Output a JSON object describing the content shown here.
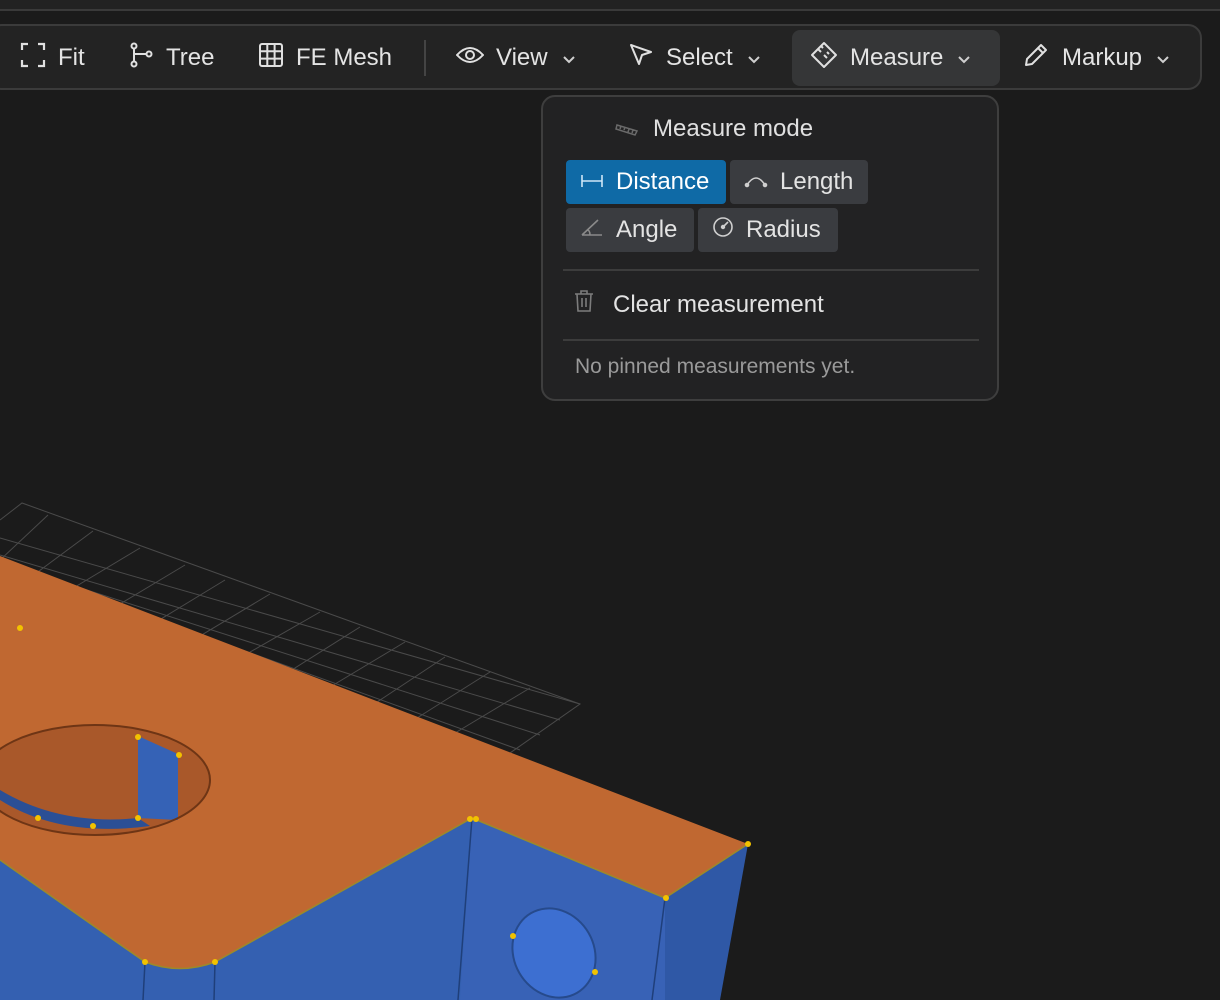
{
  "toolbar": {
    "fit": {
      "label": "Fit",
      "icon": "fit-frame-icon"
    },
    "tree": {
      "label": "Tree",
      "icon": "tree-branch-icon"
    },
    "fe_mesh": {
      "label": "FE Mesh",
      "icon": "grid-mesh-icon"
    },
    "view": {
      "label": "View",
      "icon": "eye-icon"
    },
    "select": {
      "label": "Select",
      "icon": "cursor-arrow-icon"
    },
    "measure": {
      "label": "Measure",
      "icon": "ruler-icon",
      "active": true
    },
    "markup": {
      "label": "Markup",
      "icon": "pencil-icon"
    }
  },
  "measure_menu": {
    "header": "Measure mode",
    "modes": [
      {
        "label": "Distance",
        "icon": "distance-icon",
        "selected": true
      },
      {
        "label": "Length",
        "icon": "arc-length-icon",
        "selected": false
      },
      {
        "label": "Angle",
        "icon": "angle-icon",
        "selected": false
      },
      {
        "label": "Radius",
        "icon": "radius-icon",
        "selected": false
      }
    ],
    "clear_label": "Clear measurement",
    "empty_text": "No pinned measurements yet."
  },
  "colors": {
    "background": "#1b1b1b",
    "model_top_face": "#c06831",
    "model_side_face": "#3460b1",
    "vertex_marker": "#f2c200",
    "selected_chip": "#0f6aa6"
  }
}
